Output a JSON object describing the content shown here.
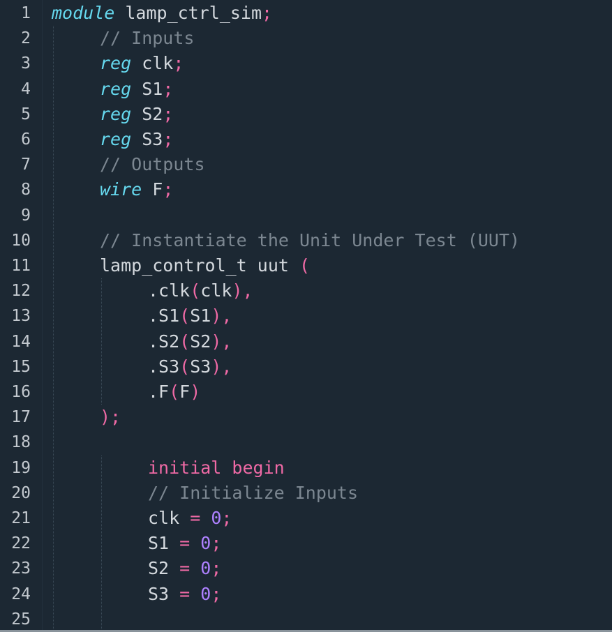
{
  "editor": {
    "colors": {
      "background": "#1c2833",
      "keyword_italic": "#66d9ef",
      "keyword": "#f06aa6",
      "comment": "#7c8791",
      "number": "#ae81ff",
      "text": "#d4d9de"
    },
    "lines": [
      {
        "n": "1",
        "indent": 0,
        "tokens": [
          {
            "t": "module",
            "c": "kw-italic"
          },
          {
            "t": " lamp_ctrl_sim",
            "c": "ident"
          },
          {
            "t": ";",
            "c": "punct"
          }
        ]
      },
      {
        "n": "2",
        "indent": 1,
        "tokens": [
          {
            "t": "// Inputs",
            "c": "cmt"
          }
        ]
      },
      {
        "n": "3",
        "indent": 1,
        "tokens": [
          {
            "t": "reg",
            "c": "kw-italic"
          },
          {
            "t": " clk",
            "c": "ident"
          },
          {
            "t": ";",
            "c": "punct"
          }
        ]
      },
      {
        "n": "4",
        "indent": 1,
        "tokens": [
          {
            "t": "reg",
            "c": "kw-italic"
          },
          {
            "t": " S1",
            "c": "ident"
          },
          {
            "t": ";",
            "c": "punct"
          }
        ]
      },
      {
        "n": "5",
        "indent": 1,
        "tokens": [
          {
            "t": "reg",
            "c": "kw-italic"
          },
          {
            "t": " S2",
            "c": "ident"
          },
          {
            "t": ";",
            "c": "punct"
          }
        ]
      },
      {
        "n": "6",
        "indent": 1,
        "tokens": [
          {
            "t": "reg",
            "c": "kw-italic"
          },
          {
            "t": " S3",
            "c": "ident"
          },
          {
            "t": ";",
            "c": "punct"
          }
        ]
      },
      {
        "n": "7",
        "indent": 1,
        "tokens": [
          {
            "t": "// Outputs",
            "c": "cmt"
          }
        ]
      },
      {
        "n": "8",
        "indent": 1,
        "tokens": [
          {
            "t": "wire",
            "c": "kw-italic"
          },
          {
            "t": " F",
            "c": "ident"
          },
          {
            "t": ";",
            "c": "punct"
          }
        ]
      },
      {
        "n": "9",
        "indent": 1,
        "tokens": []
      },
      {
        "n": "10",
        "indent": 1,
        "tokens": [
          {
            "t": "// Instantiate the Unit Under Test (UUT)",
            "c": "cmt"
          }
        ]
      },
      {
        "n": "11",
        "indent": 1,
        "tokens": [
          {
            "t": "lamp_control_t uut ",
            "c": "ident"
          },
          {
            "t": "(",
            "c": "punct"
          }
        ]
      },
      {
        "n": "12",
        "indent": 2,
        "tokens": [
          {
            "t": ".clk",
            "c": "ident"
          },
          {
            "t": "(",
            "c": "punct"
          },
          {
            "t": "clk",
            "c": "ident"
          },
          {
            "t": "),",
            "c": "punct"
          }
        ]
      },
      {
        "n": "13",
        "indent": 2,
        "tokens": [
          {
            "t": ".S1",
            "c": "ident"
          },
          {
            "t": "(",
            "c": "punct"
          },
          {
            "t": "S1",
            "c": "ident"
          },
          {
            "t": "),",
            "c": "punct"
          }
        ]
      },
      {
        "n": "14",
        "indent": 2,
        "tokens": [
          {
            "t": ".S2",
            "c": "ident"
          },
          {
            "t": "(",
            "c": "punct"
          },
          {
            "t": "S2",
            "c": "ident"
          },
          {
            "t": "),",
            "c": "punct"
          }
        ]
      },
      {
        "n": "15",
        "indent": 2,
        "tokens": [
          {
            "t": ".S3",
            "c": "ident"
          },
          {
            "t": "(",
            "c": "punct"
          },
          {
            "t": "S3",
            "c": "ident"
          },
          {
            "t": "),",
            "c": "punct"
          }
        ]
      },
      {
        "n": "16",
        "indent": 2,
        "tokens": [
          {
            "t": ".F",
            "c": "ident"
          },
          {
            "t": "(",
            "c": "punct"
          },
          {
            "t": "F",
            "c": "ident"
          },
          {
            "t": ")",
            "c": "punct"
          }
        ]
      },
      {
        "n": "17",
        "indent": 1,
        "tokens": [
          {
            "t": ");",
            "c": "punct"
          }
        ]
      },
      {
        "n": "18",
        "indent": 1,
        "tokens": []
      },
      {
        "n": "19",
        "indent": 2,
        "tokens": [
          {
            "t": "initial begin",
            "c": "kw"
          }
        ]
      },
      {
        "n": "20",
        "indent": 2,
        "tokens": [
          {
            "t": "// Initialize Inputs",
            "c": "cmt"
          }
        ]
      },
      {
        "n": "21",
        "indent": 2,
        "tokens": [
          {
            "t": "clk ",
            "c": "ident"
          },
          {
            "t": "=",
            "c": "punct"
          },
          {
            "t": " ",
            "c": "ident"
          },
          {
            "t": "0",
            "c": "num"
          },
          {
            "t": ";",
            "c": "punct"
          }
        ]
      },
      {
        "n": "22",
        "indent": 2,
        "tokens": [
          {
            "t": "S1 ",
            "c": "ident"
          },
          {
            "t": "=",
            "c": "punct"
          },
          {
            "t": " ",
            "c": "ident"
          },
          {
            "t": "0",
            "c": "num"
          },
          {
            "t": ";",
            "c": "punct"
          }
        ]
      },
      {
        "n": "23",
        "indent": 2,
        "tokens": [
          {
            "t": "S2 ",
            "c": "ident"
          },
          {
            "t": "=",
            "c": "punct"
          },
          {
            "t": " ",
            "c": "ident"
          },
          {
            "t": "0",
            "c": "num"
          },
          {
            "t": ";",
            "c": "punct"
          }
        ]
      },
      {
        "n": "24",
        "indent": 2,
        "tokens": [
          {
            "t": "S3 ",
            "c": "ident"
          },
          {
            "t": "=",
            "c": "punct"
          },
          {
            "t": " ",
            "c": "ident"
          },
          {
            "t": "0",
            "c": "num"
          },
          {
            "t": ";",
            "c": "punct"
          }
        ]
      },
      {
        "n": "25",
        "indent": 2,
        "tokens": []
      }
    ]
  }
}
